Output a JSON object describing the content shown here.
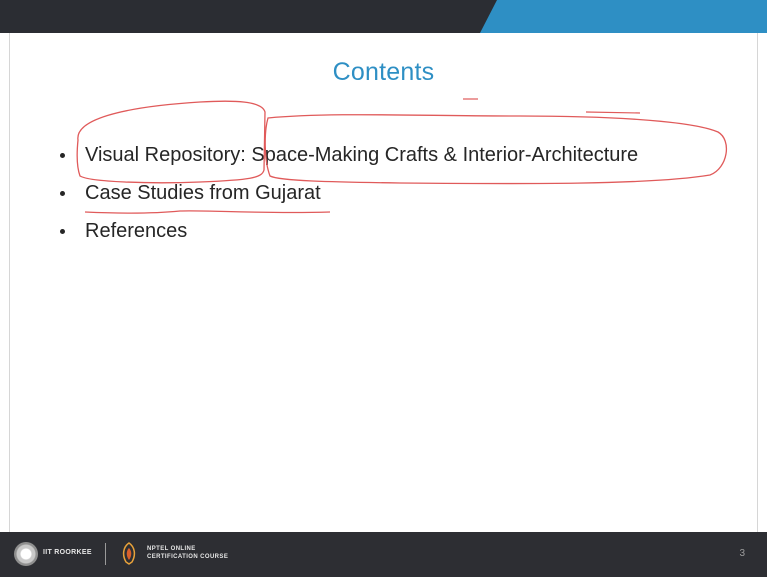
{
  "slide": {
    "title": "Contents",
    "bullets": [
      "Visual Repository: Space-Making Crafts & Interior-Architecture",
      "Case Studies from Gujarat",
      "References"
    ]
  },
  "footer": {
    "institute": "IIT ROORKEE",
    "course_line1": "NPTEL ONLINE",
    "course_line2": "CERTIFICATION COURSE",
    "page_number": "3"
  },
  "colors": {
    "title": "#2e8fc4",
    "top_band_dark": "#2b2d33",
    "top_band_accent": "#2e8fc4",
    "footer_bg": "#2d2e33",
    "annotation_ink": "#e05a5a"
  },
  "icons": [
    "iit-roorkee-logo-icon",
    "nptel-logo-icon"
  ]
}
